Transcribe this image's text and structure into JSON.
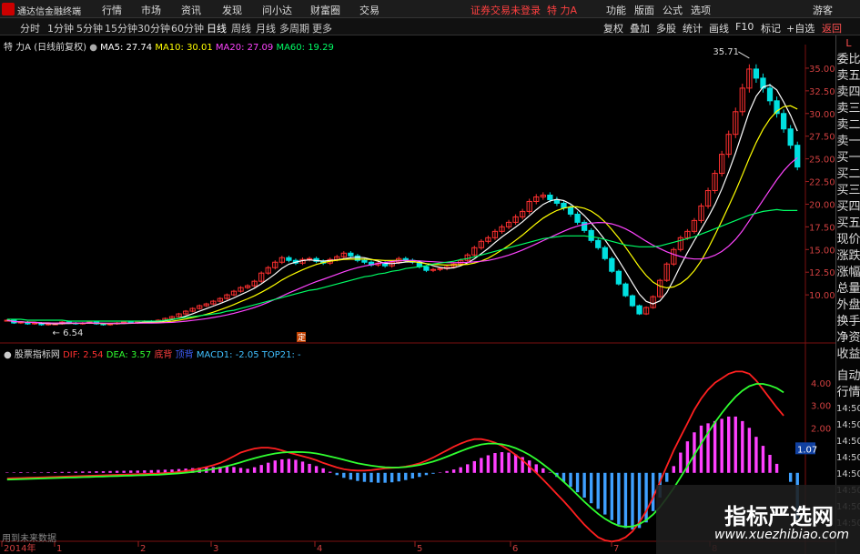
{
  "app": {
    "name": "通达信金融终端",
    "notice": "证券交易未登录",
    "stock_title": "特 力A"
  },
  "menu": [
    "行情",
    "市场",
    "资讯",
    "发现",
    "问小达",
    "财富圈",
    "交易"
  ],
  "menu_right": [
    "功能",
    "版面",
    "公式",
    "选项",
    "游客"
  ],
  "window_controls": [
    "_",
    "□",
    "×"
  ],
  "periods": [
    "分时",
    "1分钟",
    "5分钟",
    "15分钟",
    "30分钟",
    "60分钟",
    "日线",
    "周线",
    "月线",
    "多周期",
    "更多"
  ],
  "active_period": "日线",
  "tools": [
    "复权",
    "叠加",
    "多股",
    "统计",
    "画线",
    "F10",
    "标记",
    "+自选",
    "返回"
  ],
  "main_legend": {
    "name": "特 力A (日线前复权)",
    "ma5": "MA5: 27.74",
    "ma10": "MA10: 30.01",
    "ma20": "MA20: 27.09",
    "ma60": "MA60: 19.29",
    "colors": {
      "ma5": "#ffffff",
      "ma10": "#ffff00",
      "ma20": "#ff44ff",
      "ma60": "#00ff66"
    }
  },
  "sub_legend": {
    "name": "股票指标网",
    "dif": "DIF: 2.54",
    "dea": "DEA: 3.57",
    "tag1": "底背",
    "tag2": "顶背",
    "macd": "MACD1: -2.05",
    "top": "TOP21: -"
  },
  "annotations": {
    "high": "35.71",
    "low": "6.54",
    "marker": "定"
  },
  "status_hint": "用到未来数据",
  "right_panel": [
    "L",
    "委比",
    "卖五",
    "卖四",
    "卖三",
    "卖二",
    "卖一",
    "买一",
    "买二",
    "买三",
    "买四",
    "买五",
    "现价",
    "涨跌",
    "涨幅",
    "总量",
    "外盘",
    "换手",
    "净资",
    "收益",
    "",
    "自动",
    "行情",
    "14:50",
    "14:50",
    "14:50",
    "14:50",
    "14:50",
    "14:50",
    "14:50",
    "14:50"
  ],
  "watermark": {
    "title": "指标严选网",
    "url": "www.xuezhibiao.com"
  },
  "colors": {
    "up": "#ff3030",
    "down": "#00e0e0",
    "ma5": "#ffffff",
    "ma10": "#ffff00",
    "ma20": "#ff44ff",
    "ma60": "#00ff66",
    "dif": "#ff2020",
    "dea": "#30ff30",
    "macd_pos": "#ff40ff",
    "macd_neg": "#3fa0ff"
  },
  "chart_data": [
    {
      "type": "candlestick",
      "y_axis_ticks": [
        "35.00",
        "32.50",
        "30.00",
        "27.50",
        "25.00",
        "22.50",
        "20.00",
        "17.50",
        "15.00",
        "12.50",
        "10.00"
      ],
      "ylim": [
        6,
        37
      ],
      "x_ticks": [
        "2014年",
        "1",
        "2",
        "3",
        "4",
        "5",
        "6",
        "7",
        "8"
      ],
      "closes": [
        7.2,
        6.9,
        7.0,
        6.8,
        6.9,
        6.7,
        6.8,
        6.8,
        7.0,
        6.9,
        6.8,
        6.9,
        7.0,
        6.8,
        6.7,
        6.8,
        6.9,
        7.0,
        6.9,
        7.0,
        7.1,
        7.0,
        7.2,
        7.4,
        7.6,
        7.9,
        8.2,
        8.5,
        8.8,
        9.0,
        9.3,
        9.6,
        10.0,
        10.4,
        10.8,
        11.0,
        11.5,
        12.4,
        13.0,
        13.6,
        14.1,
        13.8,
        13.5,
        13.9,
        14.0,
        13.7,
        13.5,
        13.9,
        14.2,
        14.6,
        14.3,
        13.8,
        13.6,
        13.3,
        13.5,
        13.2,
        13.6,
        14.0,
        13.8,
        13.6,
        13.1,
        12.7,
        12.8,
        12.9,
        13.1,
        13.4,
        13.8,
        14.4,
        15.2,
        15.9,
        16.3,
        17.0,
        17.5,
        18.0,
        18.6,
        19.2,
        20.3,
        20.8,
        21.0,
        20.5,
        20.1,
        19.6,
        18.9,
        18.0,
        17.1,
        16.0,
        15.2,
        14.0,
        12.6,
        11.2,
        9.9,
        8.8,
        7.9,
        8.6,
        9.8,
        11.6,
        13.4,
        15.0,
        16.3,
        17.0,
        18.2,
        19.8,
        21.5,
        23.4,
        25.5,
        27.7,
        30.2,
        32.8,
        34.9,
        33.9,
        32.8,
        31.4,
        30.0,
        28.3,
        26.5,
        24.1
      ],
      "ma60": [
        7.3,
        7.3,
        7.3,
        7.2,
        7.2,
        7.2,
        7.2,
        7.2,
        7.2,
        7.1,
        7.1,
        7.1,
        7.1,
        7.1,
        7.1,
        7.1,
        7.1,
        7.1,
        7.1,
        7.1,
        7.1,
        7.1,
        7.1,
        7.2,
        7.3,
        7.4,
        7.5,
        7.6,
        7.7,
        7.8,
        7.9,
        8.0,
        8.2,
        8.3,
        8.5,
        8.7,
        8.9,
        9.1,
        9.3,
        9.5,
        9.7,
        9.9,
        10.1,
        10.3,
        10.5,
        10.6,
        10.8,
        11.0,
        11.2,
        11.4,
        11.6,
        11.8,
        12.0,
        12.1,
        12.3,
        12.4,
        12.6,
        12.7,
        12.9,
        13.0,
        13.1,
        13.2,
        13.4,
        13.5,
        13.6,
        13.7,
        13.9,
        14.0,
        14.2,
        14.4,
        14.6,
        14.8,
        15.0,
        15.2,
        15.4,
        15.6,
        15.8,
        16.0,
        16.2,
        16.3,
        16.4,
        16.5,
        16.5,
        16.5,
        16.5,
        16.4,
        16.3,
        16.1,
        15.9,
        15.7,
        15.5,
        15.4,
        15.3,
        15.3,
        15.3,
        15.4,
        15.6,
        15.8,
        16.0,
        16.2,
        16.4,
        16.7,
        17.0,
        17.3,
        17.6,
        17.9,
        18.2,
        18.5,
        18.8,
        19.0,
        19.2,
        19.3,
        19.4,
        19.3,
        19.3,
        19.3
      ],
      "high_label": "35.71",
      "low_label": "6.54"
    },
    {
      "type": "bar",
      "y_axis_ticks": [
        "4.00",
        "3.00",
        "2.00",
        "1.07"
      ],
      "ylim": [
        -3.2,
        4.8
      ],
      "macd": [
        0.02,
        0.02,
        0.03,
        0.02,
        0.02,
        0.02,
        0.03,
        0.03,
        0.04,
        0.04,
        0.05,
        0.06,
        0.06,
        0.07,
        0.07,
        0.08,
        0.09,
        0.09,
        0.1,
        0.1,
        0.11,
        0.12,
        0.13,
        0.14,
        0.15,
        0.17,
        0.19,
        0.21,
        0.23,
        0.25,
        0.26,
        0.27,
        0.28,
        0.26,
        0.22,
        0.18,
        0.25,
        0.35,
        0.45,
        0.55,
        0.6,
        0.62,
        0.58,
        0.5,
        0.4,
        0.3,
        0.2,
        0.05,
        -0.1,
        -0.22,
        -0.3,
        -0.36,
        -0.4,
        -0.42,
        -0.44,
        -0.44,
        -0.42,
        -0.38,
        -0.32,
        -0.25,
        -0.18,
        -0.1,
        -0.04,
        0.02,
        0.08,
        0.15,
        0.25,
        0.38,
        0.52,
        0.66,
        0.78,
        0.88,
        0.92,
        0.9,
        0.82,
        0.7,
        0.55,
        0.38,
        0.2,
        0.02,
        -0.18,
        -0.4,
        -0.62,
        -0.86,
        -1.1,
        -1.35,
        -1.6,
        -1.85,
        -2.1,
        -2.3,
        -2.45,
        -2.52,
        -2.45,
        -2.2,
        -1.7,
        -1.1,
        -0.4,
        0.3,
        0.9,
        1.4,
        1.8,
        2.1,
        2.2,
        2.3,
        2.4,
        2.5,
        2.5,
        2.3,
        2.0,
        1.6,
        1.2,
        0.8,
        0.4,
        0.0,
        -0.4,
        -2.05
      ],
      "dif": [
        -0.25,
        -0.24,
        -0.23,
        -0.22,
        -0.21,
        -0.2,
        -0.19,
        -0.18,
        -0.17,
        -0.16,
        -0.15,
        -0.14,
        -0.13,
        -0.12,
        -0.11,
        -0.1,
        -0.09,
        -0.08,
        -0.07,
        -0.06,
        -0.05,
        -0.04,
        -0.03,
        -0.01,
        0.01,
        0.04,
        0.08,
        0.13,
        0.19,
        0.26,
        0.34,
        0.44,
        0.58,
        0.74,
        0.9,
        1.0,
        1.08,
        1.12,
        1.12,
        1.08,
        1.0,
        0.9,
        0.82,
        0.74,
        0.66,
        0.56,
        0.44,
        0.34,
        0.24,
        0.16,
        0.12,
        0.1,
        0.1,
        0.12,
        0.16,
        0.2,
        0.22,
        0.24,
        0.28,
        0.34,
        0.42,
        0.54,
        0.68,
        0.84,
        1.0,
        1.16,
        1.3,
        1.42,
        1.5,
        1.5,
        1.44,
        1.34,
        1.2,
        1.02,
        0.8,
        0.56,
        0.28,
        0.0,
        -0.3,
        -0.62,
        -0.94,
        -1.26,
        -1.6,
        -1.96,
        -2.3,
        -2.6,
        -2.86,
        -3.0,
        -3.05,
        -3.0,
        -2.86,
        -2.6,
        -2.2,
        -1.7,
        -1.1,
        -0.4,
        0.3,
        1.0,
        1.6,
        2.2,
        2.8,
        3.3,
        3.7,
        4.0,
        4.2,
        4.4,
        4.5,
        4.5,
        4.4,
        4.1,
        3.7,
        3.3,
        2.9,
        2.54
      ],
      "dea": [
        -0.3,
        -0.29,
        -0.28,
        -0.27,
        -0.26,
        -0.25,
        -0.24,
        -0.23,
        -0.22,
        -0.21,
        -0.2,
        -0.19,
        -0.18,
        -0.17,
        -0.16,
        -0.15,
        -0.14,
        -0.13,
        -0.12,
        -0.11,
        -0.1,
        -0.09,
        -0.08,
        -0.06,
        -0.04,
        -0.02,
        0.01,
        0.04,
        0.08,
        0.12,
        0.17,
        0.23,
        0.3,
        0.38,
        0.47,
        0.56,
        0.65,
        0.73,
        0.8,
        0.86,
        0.9,
        0.92,
        0.93,
        0.92,
        0.9,
        0.86,
        0.8,
        0.73,
        0.66,
        0.58,
        0.5,
        0.43,
        0.37,
        0.32,
        0.28,
        0.25,
        0.24,
        0.24,
        0.26,
        0.3,
        0.35,
        0.42,
        0.5,
        0.6,
        0.72,
        0.84,
        0.96,
        1.08,
        1.18,
        1.26,
        1.3,
        1.3,
        1.27,
        1.2,
        1.1,
        0.96,
        0.8,
        0.6,
        0.38,
        0.14,
        -0.12,
        -0.4,
        -0.68,
        -0.98,
        -1.28,
        -1.56,
        -1.82,
        -2.04,
        -2.22,
        -2.35,
        -2.4,
        -2.38,
        -2.28,
        -2.1,
        -1.85,
        -1.52,
        -1.12,
        -0.68,
        -0.2,
        0.3,
        0.8,
        1.3,
        1.78,
        2.24,
        2.66,
        3.04,
        3.38,
        3.65,
        3.85,
        3.95,
        3.95,
        3.88,
        3.76,
        3.57
      ]
    }
  ]
}
